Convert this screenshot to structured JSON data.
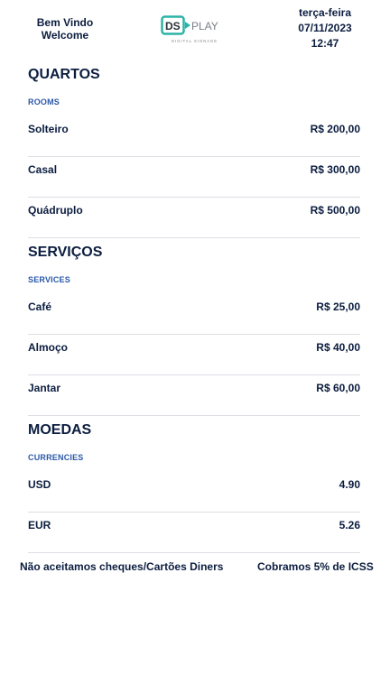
{
  "header": {
    "welcome_pt": "Bem Vindo",
    "welcome_en": "Welcome",
    "logo_primary": "DS",
    "logo_secondary": "PLAY",
    "logo_tagline": "DIGITAL SIGNAGE",
    "weekday": "terça-feira",
    "date": "07/11/2023",
    "time": "12:47"
  },
  "sections": [
    {
      "title": "QUARTOS",
      "subtitle": "ROOMS",
      "items": [
        {
          "name": "Solteiro",
          "price": "R$ 200,00"
        },
        {
          "name": "Casal",
          "price": "R$ 300,00"
        },
        {
          "name": "Quádruplo",
          "price": "R$ 500,00"
        }
      ]
    },
    {
      "title": "SERVIÇOS",
      "subtitle": "SERVICES",
      "items": [
        {
          "name": "Café",
          "price": "R$ 25,00"
        },
        {
          "name": "Almoço",
          "price": "R$ 40,00"
        },
        {
          "name": "Jantar",
          "price": "R$ 60,00"
        }
      ]
    },
    {
      "title": "MOEDAS",
      "subtitle": "CURRENCIES",
      "items": [
        {
          "name": "USD",
          "price": "4.90"
        },
        {
          "name": "EUR",
          "price": "5.26"
        }
      ]
    }
  ],
  "footer": {
    "left": "Não aceitamos cheques/Cartões Diners",
    "right": "Cobramos 5% de ICSS"
  },
  "colors": {
    "text": "#0b1d3f",
    "subtitle": "#2a58a8",
    "logo_teal": "#2bb3a6",
    "logo_gray": "#7a7f87",
    "divider": "#dcdfe4"
  }
}
